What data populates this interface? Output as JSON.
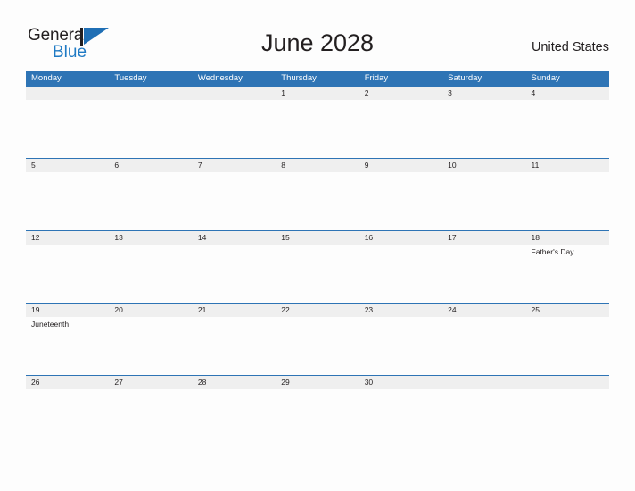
{
  "header": {
    "logo": {
      "word1": "General",
      "word2": "Blue",
      "icon": "flag-triangle-icon",
      "brand_dark": "#231f20",
      "brand_blue": "#1f7ac4"
    },
    "title": "June 2028",
    "country": "United States"
  },
  "theme": {
    "header_bar": "#2e74b5",
    "row_band": "#efefef",
    "page_bg": "#fdfdfd",
    "text": "#231f20",
    "header_text": "#ffffff"
  },
  "calendar": {
    "month": "June",
    "year": "2028",
    "weekdays": [
      "Monday",
      "Tuesday",
      "Wednesday",
      "Thursday",
      "Friday",
      "Saturday",
      "Sunday"
    ],
    "weeks": [
      {
        "days": [
          {
            "num": "",
            "events": ""
          },
          {
            "num": "",
            "events": ""
          },
          {
            "num": "",
            "events": ""
          },
          {
            "num": "1",
            "events": ""
          },
          {
            "num": "2",
            "events": ""
          },
          {
            "num": "3",
            "events": ""
          },
          {
            "num": "4",
            "events": ""
          }
        ]
      },
      {
        "days": [
          {
            "num": "5",
            "events": ""
          },
          {
            "num": "6",
            "events": ""
          },
          {
            "num": "7",
            "events": ""
          },
          {
            "num": "8",
            "events": ""
          },
          {
            "num": "9",
            "events": ""
          },
          {
            "num": "10",
            "events": ""
          },
          {
            "num": "11",
            "events": ""
          }
        ]
      },
      {
        "days": [
          {
            "num": "12",
            "events": ""
          },
          {
            "num": "13",
            "events": ""
          },
          {
            "num": "14",
            "events": ""
          },
          {
            "num": "15",
            "events": ""
          },
          {
            "num": "16",
            "events": ""
          },
          {
            "num": "17",
            "events": ""
          },
          {
            "num": "18",
            "events": "Father's Day"
          }
        ]
      },
      {
        "days": [
          {
            "num": "19",
            "events": "Juneteenth"
          },
          {
            "num": "20",
            "events": ""
          },
          {
            "num": "21",
            "events": ""
          },
          {
            "num": "22",
            "events": ""
          },
          {
            "num": "23",
            "events": ""
          },
          {
            "num": "24",
            "events": ""
          },
          {
            "num": "25",
            "events": ""
          }
        ]
      },
      {
        "days": [
          {
            "num": "26",
            "events": ""
          },
          {
            "num": "27",
            "events": ""
          },
          {
            "num": "28",
            "events": ""
          },
          {
            "num": "29",
            "events": ""
          },
          {
            "num": "30",
            "events": ""
          },
          {
            "num": "",
            "events": ""
          },
          {
            "num": "",
            "events": ""
          }
        ]
      }
    ]
  }
}
